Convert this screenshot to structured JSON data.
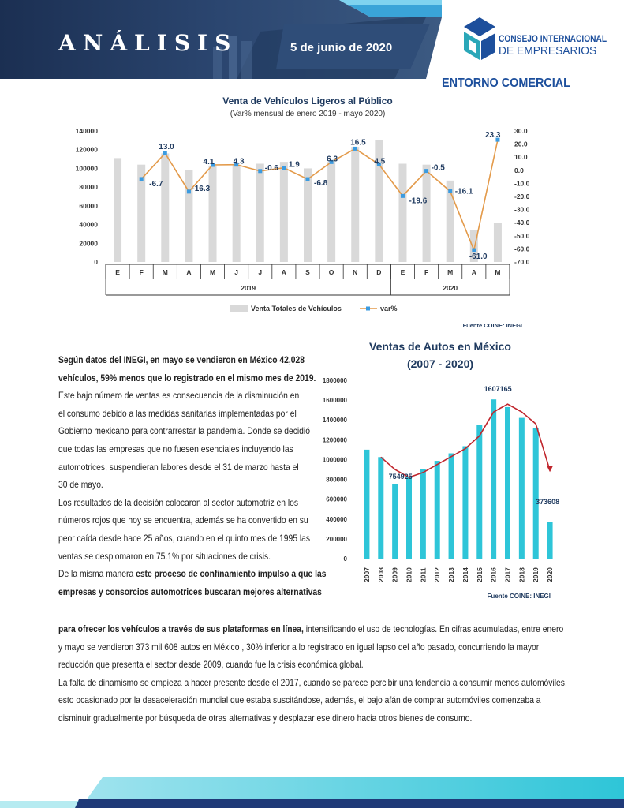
{
  "header": {
    "title": "ANÁLISIS",
    "date": "5 de junio de 2020",
    "logo_line1": "CONSEJO INTERNACIONAL",
    "logo_line2": "DE EMPRESARIOS",
    "section": "ENTORNO COMERCIAL"
  },
  "colors": {
    "navy": "#1f3a5f",
    "brand_blue": "#1d4f9c",
    "cyan": "#2ec5d8",
    "bar_grey": "#d9d9d9",
    "line_orange": "#e39a4a",
    "marker_blue": "#3b9be0",
    "line_red": "#c0262d"
  },
  "chart_data": [
    {
      "type": "bar",
      "title": "Venta de Vehículos Ligeros al Público",
      "subtitle": "(Var% mensual de enero 2019 - mayo 2020)",
      "categories": [
        "E",
        "F",
        "M",
        "A",
        "M",
        "J",
        "J",
        "A",
        "S",
        "O",
        "N",
        "D",
        "E",
        "F",
        "M",
        "A",
        "M"
      ],
      "groups": [
        {
          "label": "2019",
          "span": 12
        },
        {
          "label": "2020",
          "span": 5
        }
      ],
      "ylim": [
        0,
        140000
      ],
      "yticks": [
        "0",
        "20000",
        "40000",
        "60000",
        "80000",
        "100000",
        "120000",
        "140000"
      ],
      "y2lim": [
        -70,
        30
      ],
      "y2ticks": [
        "30.0",
        "20.0",
        "10.0",
        "0.0",
        "-10.0",
        "-20.0",
        "-30.0",
        "-40.0",
        "-50.0",
        "-60.0",
        "-70.0"
      ],
      "series": [
        {
          "name": "Venta Totales de Vehículos",
          "type": "bar",
          "values": [
            111000,
            104000,
            116000,
            98000,
            103000,
            104000,
            105000,
            107000,
            100000,
            107000,
            123000,
            130000,
            105000,
            104000,
            87000,
            34000,
            42028
          ]
        },
        {
          "name": "var%",
          "type": "line",
          "values": [
            -6.7,
            13.0,
            -16.3,
            4.1,
            4.3,
            -0.6,
            1.9,
            -6.8,
            6.3,
            16.5,
            4.5,
            -19.6,
            -0.5,
            -16.1,
            -61.0,
            23.3
          ],
          "labels": [
            "-6.7",
            "13.0",
            "-16.3",
            "4.1",
            "4.3",
            "-0.6",
            "1.9",
            "-6.8",
            "6.3",
            "16.5",
            "4.5",
            "-19.6",
            "-0.5",
            "-16.1",
            "-61.0",
            "23.3"
          ]
        }
      ],
      "source": "Fuente COINE: INEGI"
    },
    {
      "type": "bar",
      "title_line1": "Ventas de Autos en México",
      "title_line2": "(2007 - 2020)",
      "categories": [
        "2007",
        "2008",
        "2009",
        "2010",
        "2011",
        "2012",
        "2013",
        "2014",
        "2015",
        "2016",
        "2017",
        "2018",
        "2019",
        "2020"
      ],
      "ylim": [
        0,
        1800000
      ],
      "yticks": [
        "0",
        "200000",
        "400000",
        "600000",
        "800000",
        "1000000",
        "1200000",
        "1400000",
        "1600000",
        "1800000"
      ],
      "values": [
        1100000,
        1025000,
        754925,
        820000,
        905000,
        987000,
        1063000,
        1135000,
        1351000,
        1607165,
        1530000,
        1421000,
        1318000,
        373608
      ],
      "trend": [
        1025000,
        900000,
        820000,
        870000,
        950000,
        1030000,
        1110000,
        1240000,
        1480000,
        1560000,
        1480000,
        1360000,
        890000
      ],
      "labels": [
        {
          "index": 2,
          "text": "754925"
        },
        {
          "index": 9,
          "text": "1607165"
        },
        {
          "index": 13,
          "text": "373608"
        }
      ],
      "source": "Fuente COINE: INEGI"
    }
  ],
  "text": {
    "p1_lines": [
      {
        "b": "Según datos del INEGI, en mayo se vendieron en México 42,028"
      },
      {
        "b": "vehículos, 59% menos que lo registrado en el mismo mes de 2019."
      },
      {
        "t": "Este bajo número de ventas es consecuencia de la disminución en"
      },
      {
        "t": "el consumo debido a las medidas sanitarias implementadas por el"
      },
      {
        "t": "Gobierno mexicano para contrarrestar la pandemia. Donde se decidió"
      },
      {
        "t": "que todas las empresas que no fuesen esenciales incluyendo las"
      },
      {
        "t": "automotrices, suspendieran labores desde el 31 de marzo hasta el"
      },
      {
        "t": "30 de mayo."
      },
      {
        "t": "Los resultados de la decisión colocaron al sector automotriz en los"
      },
      {
        "t": "números rojos que hoy se encuentra, además se ha convertido en su"
      },
      {
        "t": "peor caída desde hace 25 años, cuando en el quinto mes de 1995 las"
      },
      {
        "t": "ventas se desplomaron en 75.1%  por situaciones de crisis."
      },
      {
        "t": "De la misma manera ",
        "b": "este proceso de confinamiento impulso a que las"
      },
      {
        "b": "empresas y consorcios automotrices buscaran mejores alternativas"
      }
    ],
    "p2_lines": [
      {
        "b": "para ofrecer los vehículos a través de sus plataformas en línea,",
        "t": " intensificando el uso de tecnologías. En cifras acumuladas, entre enero"
      },
      {
        "t": "y mayo se vendieron 373 mil 608 autos en México , 30% inferior a lo registrado en igual lapso del año pasado, concurriendo la mayor"
      },
      {
        "t": "reducción que presenta el sector desde 2009, cuando fue la crisis económica global."
      },
      {
        "t": "La falta de dinamismo se empieza a hacer presente  desde el  2017, cuando se parece percibir una tendencia a consumir menos automóviles,"
      },
      {
        "t": "esto ocasionado por la desaceleración mundial que estaba suscitándose, además, el bajo afán de comprar automóviles comenzaba a"
      },
      {
        "t": "disminuir gradualmente por búsqueda de otras alternativas y desplazar ese dinero hacia otros bienes de consumo."
      }
    ]
  }
}
